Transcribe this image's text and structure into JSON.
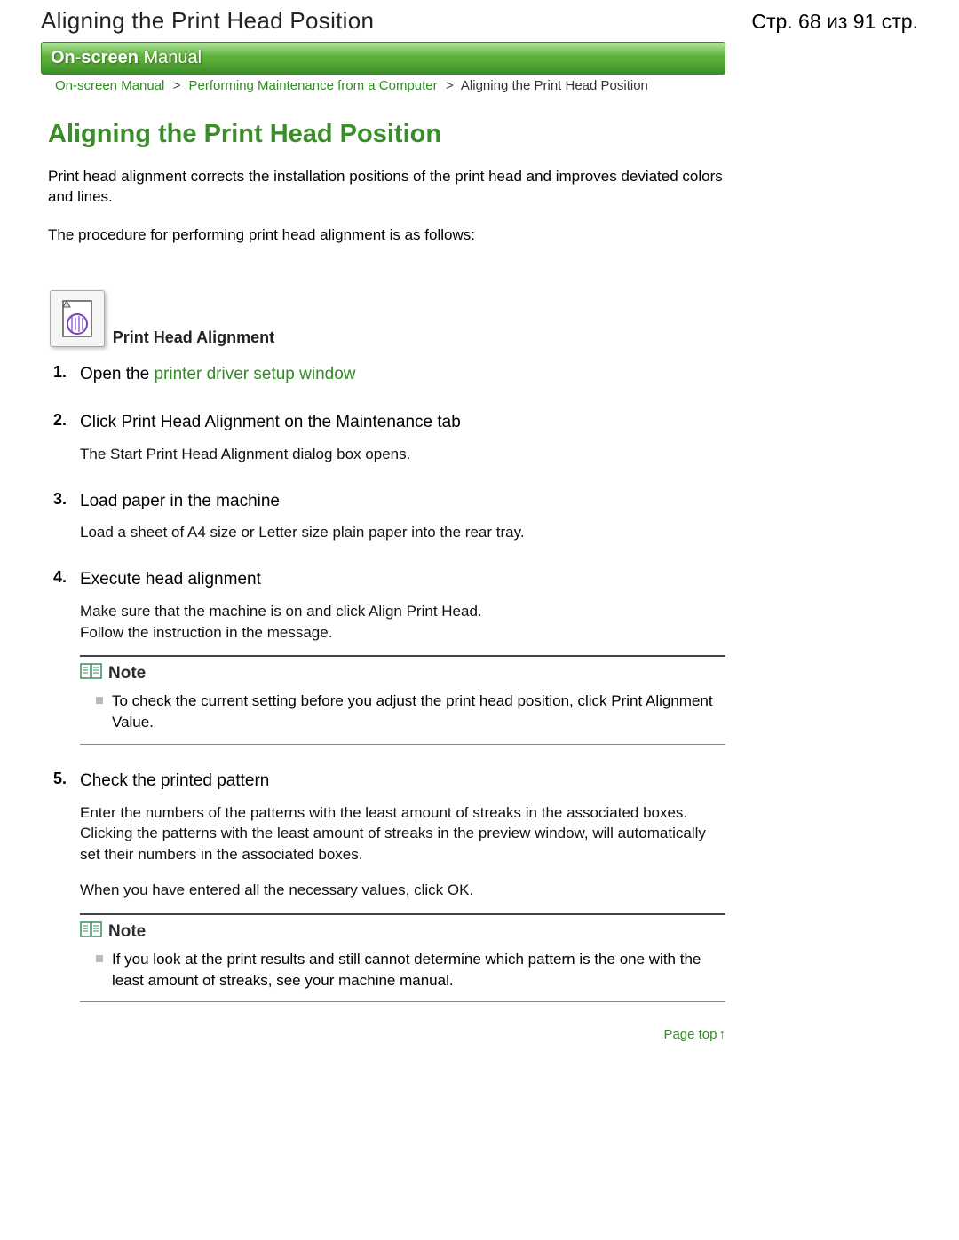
{
  "header": {
    "title": "Aligning the Print Head Position",
    "page_indicator": "Стр. 68 из 91 стр."
  },
  "banner": {
    "bold": "On-screen",
    "light": "Manual"
  },
  "breadcrumb": {
    "items": [
      {
        "label": "On-screen Manual",
        "link": true
      },
      {
        "label": "Performing Maintenance from a Computer",
        "link": true
      },
      {
        "label": "Aligning the Print Head Position",
        "link": false
      }
    ],
    "sep": ">"
  },
  "page_title": "Aligning the Print Head Position",
  "intro": [
    "Print head alignment corrects the installation positions of the print head and improves deviated colors and lines.",
    "The procedure for performing print head alignment is as follows:"
  ],
  "icon_label": "Print Head Alignment",
  "steps": [
    {
      "num": "1.",
      "title_prefix": "Open the ",
      "title_link": "printer driver setup window"
    },
    {
      "num": "2.",
      "title": "Click Print Head Alignment on the Maintenance tab",
      "body": [
        "The Start Print Head Alignment dialog box opens."
      ]
    },
    {
      "num": "3.",
      "title": "Load paper in the machine",
      "body": [
        "Load a sheet of A4 size or Letter size plain paper into the rear tray."
      ]
    },
    {
      "num": "4.",
      "title": "Execute head alignment",
      "body": [
        "Make sure that the machine is on and click Align Print Head.",
        "Follow the instruction in the message."
      ],
      "note": {
        "label": "Note",
        "items": [
          "To check the current setting before you adjust the print head position, click Print Alignment Value."
        ]
      }
    },
    {
      "num": "5.",
      "title": "Check the printed pattern",
      "body": [
        "Enter the numbers of the patterns with the least amount of streaks in the associated boxes. Clicking the patterns with the least amount of streaks in the preview window, will automatically set their numbers in the associated boxes.",
        "When you have entered all the necessary values, click OK."
      ],
      "note": {
        "label": "Note",
        "items": [
          "If you look at the print results and still cannot determine which pattern is the one with the least amount of streaks, see your machine manual."
        ]
      }
    }
  ],
  "page_top": "Page top"
}
